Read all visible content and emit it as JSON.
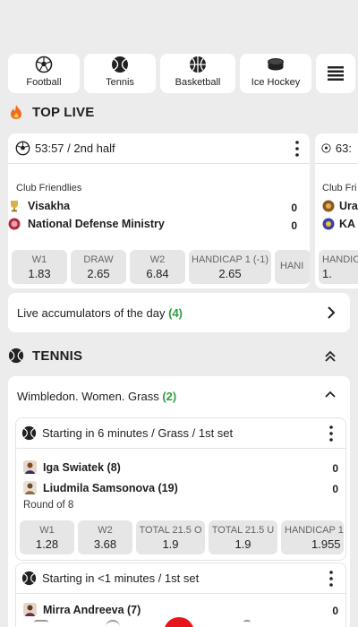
{
  "sports": [
    {
      "label": "Football",
      "icon": "football-icon"
    },
    {
      "label": "Tennis",
      "icon": "tennis-ball-icon"
    },
    {
      "label": "Basketball",
      "icon": "basketball-icon"
    },
    {
      "label": "Ice Hockey",
      "icon": "hockey-puck-icon"
    }
  ],
  "top_live": {
    "title": "TOP LIVE",
    "card": {
      "time": "53:57 / 2nd half",
      "league": "Club Friendlies",
      "team1": "Visakha",
      "team2": "National Defense Ministry",
      "score1": "0",
      "score2": "0",
      "odds": [
        {
          "label": "W1",
          "value": "1.83"
        },
        {
          "label": "DRAW",
          "value": "2.65"
        },
        {
          "label": "W2",
          "value": "6.84"
        },
        {
          "label": "HANDICAP 1 (-1)",
          "value": "2.65"
        },
        {
          "label": "HANI",
          "value": ""
        }
      ]
    },
    "card2": {
      "time": "63:",
      "league": "Club Fri",
      "team1": "Ura",
      "team2": "KA",
      "odds": [
        {
          "label": "HANDIC",
          "value": "1."
        }
      ]
    }
  },
  "accumulators": {
    "label": "Live accumulators of the day",
    "count": "(4)"
  },
  "tennis": {
    "title": "TENNIS",
    "tournament": "Wimbledon. Women. Grass",
    "tournament_count": "(2)",
    "match1": {
      "status": "Starting in 6 minutes / Grass / 1st set",
      "player1": "Iga Swiatek (8)",
      "player2": "Liudmila Samsonova (19)",
      "score1": "0",
      "score2": "0",
      "round": "Round of 8",
      "odds": [
        {
          "label": "W1",
          "value": "1.28"
        },
        {
          "label": "W2",
          "value": "3.68"
        },
        {
          "label": "TOTAL 21.5 O",
          "value": "1.9"
        },
        {
          "label": "TOTAL 21.5 U",
          "value": "1.9"
        },
        {
          "label": "HANDICAP 1",
          "value": "1.955"
        }
      ]
    },
    "match2": {
      "status": "Starting in <1 minutes / 1st set",
      "player1": "Mirra Andreeva (7)",
      "score1": "0"
    }
  },
  "colors": {
    "accent_green": "#2e9e3f",
    "brand_red": "#e8141b"
  }
}
